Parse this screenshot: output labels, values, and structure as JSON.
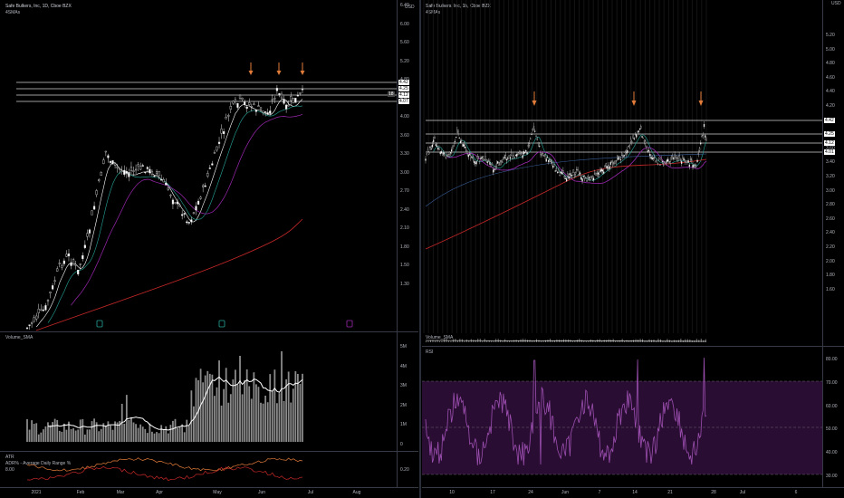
{
  "left": {
    "title": "Safe Bulkers, Inc, 1D, Cboe BZX",
    "indicator": "4SMAs",
    "currency": "USD",
    "price_axis": [
      "6.40",
      "6.00",
      "5.60",
      "5.20",
      "4.80",
      "4.40",
      "4.00",
      "3.60",
      "3.30",
      "3.00",
      "2.70",
      "2.40",
      "2.10",
      "1.80",
      "1.50",
      "1.30"
    ],
    "hline_tags": [
      "4.42",
      "4.25",
      "4.12",
      "4.07"
    ],
    "mid_tag": "18",
    "volume_label": "Volume_SMA",
    "volume_axis": [
      "5M",
      "4M",
      "3M",
      "2M",
      "1M",
      "0"
    ],
    "atr_label": "ATR",
    "adr_label": "ADR% - Average Daily Range %",
    "atr_left_value": "8.00",
    "atr_axis": "0.20",
    "x_axis": [
      "2021",
      "Feb",
      "Mar",
      "Apr",
      "May",
      "Jun",
      "Jul",
      "Aug"
    ]
  },
  "right": {
    "title": "Safe Bulkers, Inc, 1h, Cboe BZX",
    "indicator": "4SMAs",
    "currency": "USD",
    "price_axis": [
      "5.20",
      "5.00",
      "4.80",
      "4.60",
      "4.40",
      "4.20",
      "4.00",
      "3.80",
      "3.60",
      "3.40",
      "3.20",
      "3.00",
      "2.80",
      "2.60",
      "2.40",
      "2.20",
      "2.00",
      "1.80",
      "1.60"
    ],
    "hline_tags": [
      "4.42",
      "4.25",
      "4.12",
      "4.01"
    ],
    "volume_label": "Volume_SMA",
    "rsi_label": "RSI",
    "rsi_axis": [
      "80.00",
      "70.00",
      "60.00",
      "50.00",
      "40.00",
      "30.00"
    ],
    "x_axis": [
      "10",
      "17",
      "24",
      "Jun",
      "7",
      "14",
      "21",
      "28",
      "Jul",
      "6"
    ]
  },
  "colors": {
    "background": "#000000",
    "up_candle": "#ffffff",
    "down_candle": "#e0e0e0",
    "sma_teal": "#26a69a",
    "sma_purple": "#9c27b0",
    "sma_red": "#c62828",
    "sma_white": "#ffffff",
    "arrow": "#e07b39",
    "rsi_fill": "#2a0d33",
    "rsi_line": "#9c4fb0",
    "volume_bar": "#8a8a8a",
    "atr_red": "#c62828",
    "atr_orange": "#e07b39"
  }
}
